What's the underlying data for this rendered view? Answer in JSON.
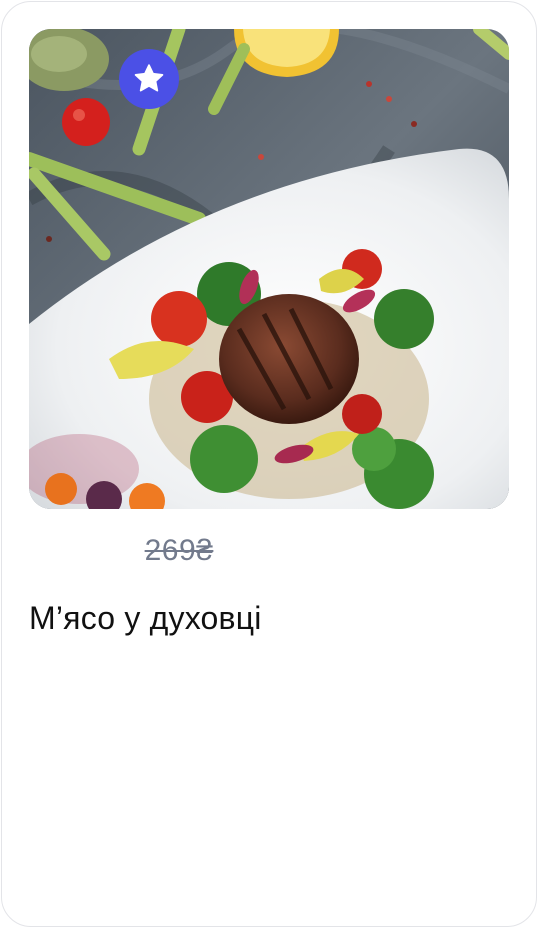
{
  "product": {
    "image_alt": "Steak with grilled vegetables",
    "favorite_icon": "star-icon",
    "old_price": "269₴",
    "title": "М’ясо у духовці"
  },
  "colors": {
    "accent": "#4b50e6",
    "old_price": "#727a8c",
    "title": "#111111",
    "card_border": "#e3e4e8"
  }
}
